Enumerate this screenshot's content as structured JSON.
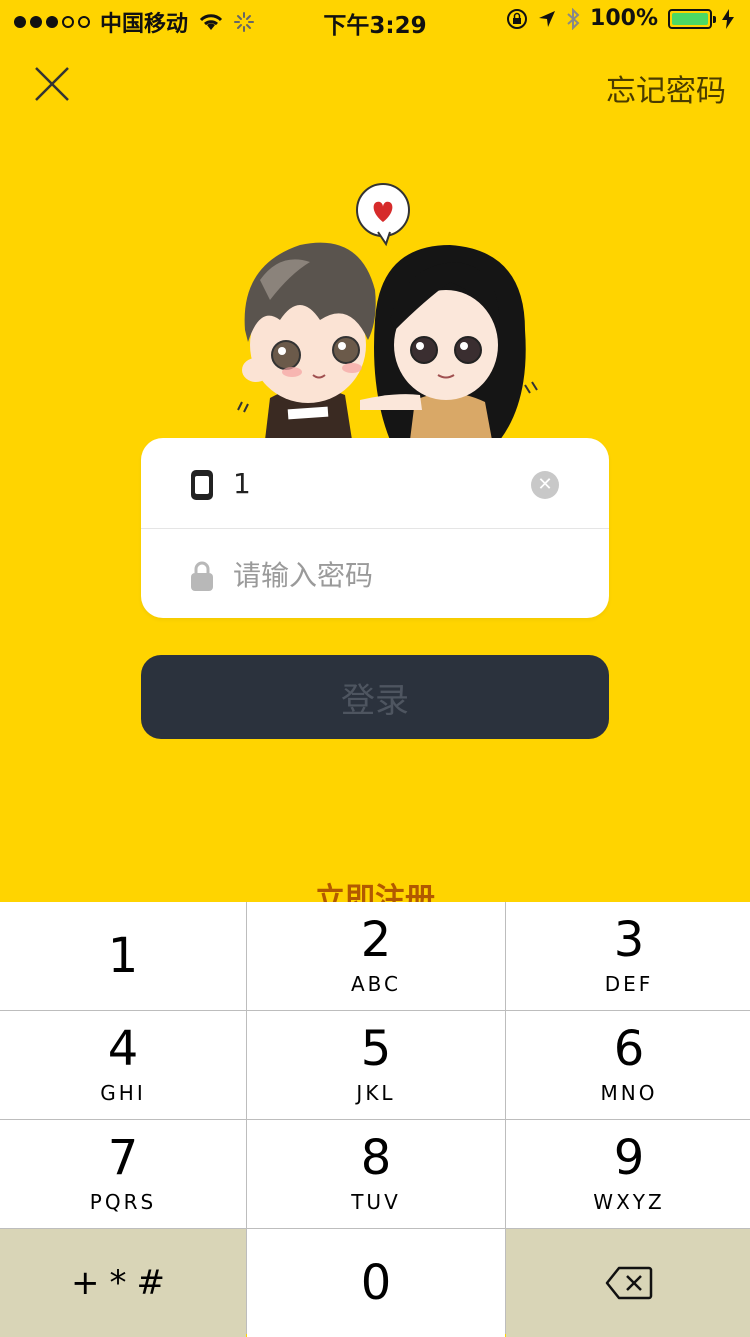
{
  "status_bar": {
    "carrier": "中国移动",
    "time": "下午3:29",
    "battery_percent": "100%"
  },
  "nav": {
    "forgot_password": "忘记密码"
  },
  "form": {
    "phone_value": "1",
    "password_placeholder": "请输入密码",
    "login_label": "登录"
  },
  "register_peek": "立即注册",
  "keypad": {
    "keys": [
      {
        "num": "1",
        "letters": ""
      },
      {
        "num": "2",
        "letters": "ABC"
      },
      {
        "num": "3",
        "letters": "DEF"
      },
      {
        "num": "4",
        "letters": "GHI"
      },
      {
        "num": "5",
        "letters": "JKL"
      },
      {
        "num": "6",
        "letters": "MNO"
      },
      {
        "num": "7",
        "letters": "PQRS"
      },
      {
        "num": "8",
        "letters": "TUV"
      },
      {
        "num": "9",
        "letters": "WXYZ"
      },
      {
        "num": "0",
        "letters": ""
      }
    ],
    "symbols": "+*#"
  },
  "colors": {
    "background": "#FFD400",
    "button_dark": "#2B323D",
    "battery": "#4CD964"
  }
}
